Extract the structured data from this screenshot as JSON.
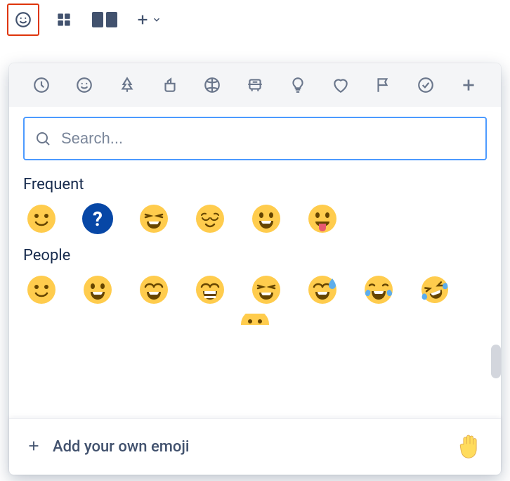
{
  "toolbar": {
    "items": [
      {
        "name": "emoji-icon",
        "active": true
      },
      {
        "name": "table-icon"
      },
      {
        "name": "layouts-icon"
      },
      {
        "name": "insert-plus-icon"
      }
    ]
  },
  "picker": {
    "categories": [
      {
        "name": "frequent-icon"
      },
      {
        "name": "people-icon"
      },
      {
        "name": "nature-icon"
      },
      {
        "name": "food-icon"
      },
      {
        "name": "activity-icon"
      },
      {
        "name": "travel-icon"
      },
      {
        "name": "objects-icon"
      },
      {
        "name": "symbols-icon"
      },
      {
        "name": "flags-icon"
      },
      {
        "name": "productivity-icon"
      },
      {
        "name": "custom-icon"
      }
    ],
    "search": {
      "placeholder": "Search...",
      "value": ""
    },
    "sections": [
      {
        "label": "Frequent",
        "emojis": [
          {
            "name": "slightly-smiling-face",
            "glyph": "slight_smile"
          },
          {
            "name": "blue-question-mark",
            "glyph": "question"
          },
          {
            "name": "laughing-squinting-face",
            "glyph": "laughing_squint"
          },
          {
            "name": "relieved-face",
            "glyph": "relieved"
          },
          {
            "name": "grinning-face-big-eyes",
            "glyph": "grin_big"
          },
          {
            "name": "face-with-tongue",
            "glyph": "tongue"
          }
        ]
      },
      {
        "label": "People",
        "emojis": [
          {
            "name": "slightly-smiling-face",
            "glyph": "slight_smile"
          },
          {
            "name": "grinning-face-big-eyes",
            "glyph": "grin_big"
          },
          {
            "name": "grinning-smiling-eyes",
            "glyph": "grin_smile_eyes"
          },
          {
            "name": "beaming-smiling-eyes",
            "glyph": "beaming"
          },
          {
            "name": "laughing-squinting-face",
            "glyph": "laughing_squint"
          },
          {
            "name": "grinning-sweat",
            "glyph": "grin_sweat"
          },
          {
            "name": "tears-of-joy",
            "glyph": "joy"
          },
          {
            "name": "rolling-on-floor-laughing",
            "glyph": "rofl"
          }
        ]
      }
    ],
    "footer": {
      "label": "Add your own emoji",
      "preview": "raised-hand"
    }
  }
}
